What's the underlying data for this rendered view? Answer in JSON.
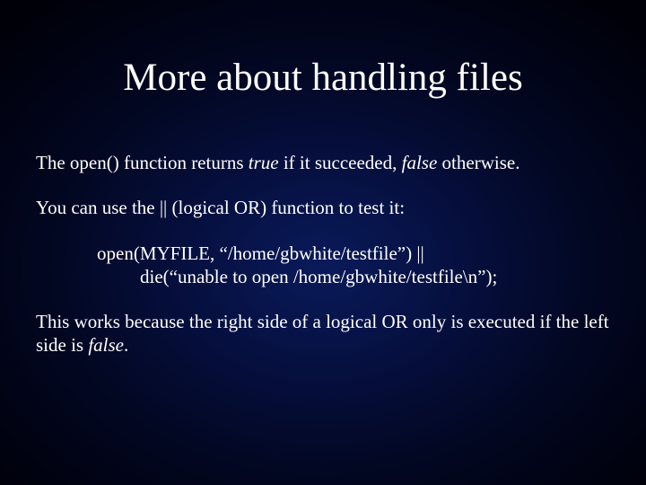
{
  "title": "More about handling files",
  "p1_a": "The open() function returns ",
  "p1_true": "true",
  "p1_b": " if it succeeded, ",
  "p1_false": "false",
  "p1_c": " otherwise.",
  "p2": "You can use the || (logical OR) function to test it:",
  "code1": "open(MYFILE, “/home/gbwhite/testfile”) ||",
  "code2": "die(“unable to open /home/gbwhite/testfile\\n”);",
  "p3_a": "This works because the right side of a logical OR only is executed if the left side is ",
  "p3_false": "false",
  "p3_b": "."
}
